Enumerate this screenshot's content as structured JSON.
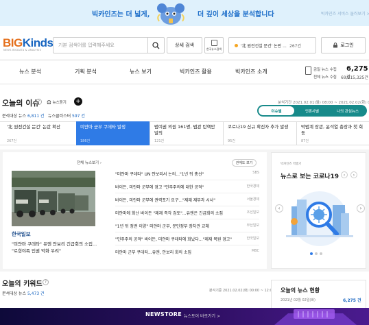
{
  "banner": {
    "text_left": "빅카인즈는 더 넓게,",
    "text_right": "더 깊이 세상을 분석합니다",
    "link": "빅카인즈 서비스 둘러보기 >"
  },
  "header": {
    "logo_big": "BIG",
    "logo_kinds": "Kinds",
    "logo_sub": "NEWS BIGDATA & ANALYSIS",
    "search_placeholder": "기본 검색어를 입력해주세요",
    "advanced_search": "상세 검색",
    "english_news": "한국뉴스검색",
    "hot_issue": "'北 원전건설 문건' 논란 ...",
    "hot_issue_count": "267건",
    "login": "로그인"
  },
  "nav": {
    "items": [
      "뉴스 분석",
      "기획 분석",
      "뉴스 보기",
      "빅카인즈 활용",
      "빅카인즈 소개"
    ],
    "stat_label1": "금일 뉴스 수집",
    "stat_label2": "전체 뉴스 수집",
    "stat_today": "6,275",
    "stat_today_unit": "건",
    "stat_total": "69,615,325",
    "stat_total_unit": "건"
  },
  "issues": {
    "title": "오늘의 이슈",
    "listen": "뉴스듣기",
    "analysis_news_label": "분석대상 뉴스",
    "analysis_news_count": "6,811 건",
    "clusters_label": "뉴스클러스터",
    "clusters_count": "597 건",
    "date_range": "분석기간 2021.02.01(월) 08:00 ~ 2021.02.02(화) 08:00",
    "tabs": [
      "이슈별",
      "언론사별",
      "나의 관심뉴스"
    ],
    "cards": [
      {
        "title": "'北 원전건설 문건' 논란 확산",
        "count": "267건"
      },
      {
        "title": "미얀마 군부 쿠데타 발생",
        "count": "186건"
      },
      {
        "title": "범여권 의원 161명, 법관 탄핵안 발의",
        "count": "121건"
      },
      {
        "title": "코로나19 신규 확진자 추가 발생",
        "count": "95건"
      },
      {
        "title": "박범계 장관, 윤석열 총장과 첫 회동",
        "count": "87건"
      }
    ]
  },
  "news": {
    "list_label": "전체 뉴스보기",
    "keyword_btn": "관계도 보기",
    "source_logo": "한국일보",
    "main_headline": "\"미얀마 쿠데타\" 유엔 안보리 긴급회의 소집... \"로힝야족 인권 악화 우려\"",
    "rows": [
      {
        "title": "\"미얀마 쿠데타\" UN 안보리서 논의...\"1년 뒤 총선\"",
        "source": "SBS"
      },
      {
        "title": "바이든, 미얀마 군부에 경고 \"민주주의에 대한 공격\"",
        "source": "한국경제"
      },
      {
        "title": "바이든, 미얀마 군부에 권력포기 요구...\"제재 재부과 시사\"",
        "source": "서울경제"
      },
      {
        "title": "미얀마에 화난 바이든 \"제재 즉각 검토\"...유엔은 긴급회의 소집",
        "source": "조선일보"
      },
      {
        "title": "\"1년 뒤 정권 이양\" 미얀마 군부, 문민정부 장차관 교체",
        "source": "부산일보"
      },
      {
        "title": "\"민주주의 공격\" 바이든, 미얀마 쿠데타에 화났다...\"제재 복원 경고\"",
        "source": "한국일보"
      },
      {
        "title": "미얀마 군부 쿠데타...유엔, 안보리 회의 소집",
        "source": "MBC"
      }
    ]
  },
  "covid": {
    "subtitle": "빅카인즈 빅뱅기",
    "title": "뉴스로 보는 코로나19"
  },
  "keywords": {
    "title": "오늘의 키워드",
    "analysis_label": "분석대상 뉴스",
    "analysis_count": "5,473 건",
    "date": "분석기준 2021.02.02(화) 00:00 ~ 12:00"
  },
  "status": {
    "title": "오늘의 뉴스 현황",
    "row_label": "2021년 02월 02일(화)",
    "row_value": "6,275 건"
  },
  "bottom_banner": {
    "logo": "NEWSTORE",
    "text": "뉴스토어 바로가기 >"
  },
  "colors": {
    "accent_blue": "#2f7be6",
    "teal": "#178a8a",
    "logo_orange": "#e46f1b",
    "banner_bg": "#dff1fc"
  }
}
